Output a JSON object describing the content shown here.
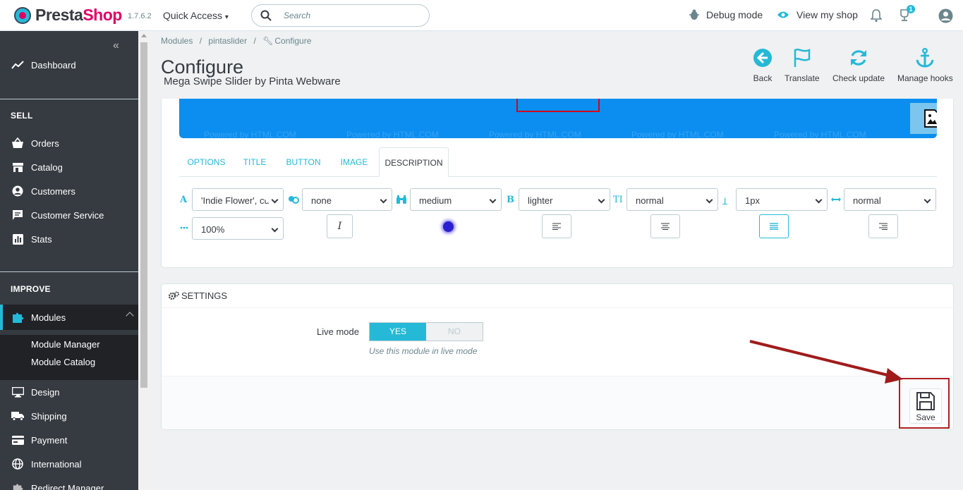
{
  "header": {
    "logo_text_1": "Presta",
    "logo_text_2": "Shop",
    "version": "1.7.6.2",
    "quick_access": "Quick Access",
    "search_placeholder": "Search",
    "debug_mode": "Debug mode",
    "view_my_shop": "View my shop",
    "notifications_count": "1"
  },
  "sidebar": {
    "collapse_glyph": "«",
    "dashboard": "Dashboard",
    "section_sell": "SELL",
    "orders": "Orders",
    "catalog": "Catalog",
    "customers": "Customers",
    "customer_service": "Customer Service",
    "stats": "Stats",
    "section_improve": "IMPROVE",
    "modules": "Modules",
    "module_manager": "Module Manager",
    "module_catalog": "Module Catalog",
    "design": "Design",
    "shipping": "Shipping",
    "payment": "Payment",
    "international": "International",
    "redirect_manager": "Redirect Manager"
  },
  "breadcrumb": {
    "item1": "Modules",
    "sep": "/",
    "item2": "pintaslider",
    "item3": "Configure"
  },
  "page": {
    "title": "Configure",
    "subtitle": "Mega Swipe Slider by Pinta Webware"
  },
  "toolbar": {
    "back": "Back",
    "translate": "Translate",
    "check_update": "Check update",
    "manage_hooks": "Manage hooks"
  },
  "slider_preview": {
    "watermark": "Powered by HTML.COM"
  },
  "tabs": [
    "OPTIONS",
    "TITLE",
    "BUTTON",
    "IMAGE",
    "DESCRIPTION"
  ],
  "active_tab": "DESCRIPTION",
  "description_controls": {
    "font_family": "'Indie Flower', cu",
    "text_shadow": "none",
    "font_size": "medium",
    "font_weight": "lighter",
    "text_transform": "normal",
    "letter_spacing": "1px",
    "word_spacing": "normal",
    "line_height": "100%",
    "color": "#2a1fd0"
  },
  "settings": {
    "heading": "SETTINGS",
    "live_mode_label": "Live mode",
    "yes": "YES",
    "no": "NO",
    "help": "Use this module in live mode",
    "save": "Save"
  },
  "colors": {
    "accent": "#25b9d7",
    "sidebar_bg": "#363a41",
    "brand_pink": "#df0067",
    "annotation_red": "#b01f1f"
  }
}
